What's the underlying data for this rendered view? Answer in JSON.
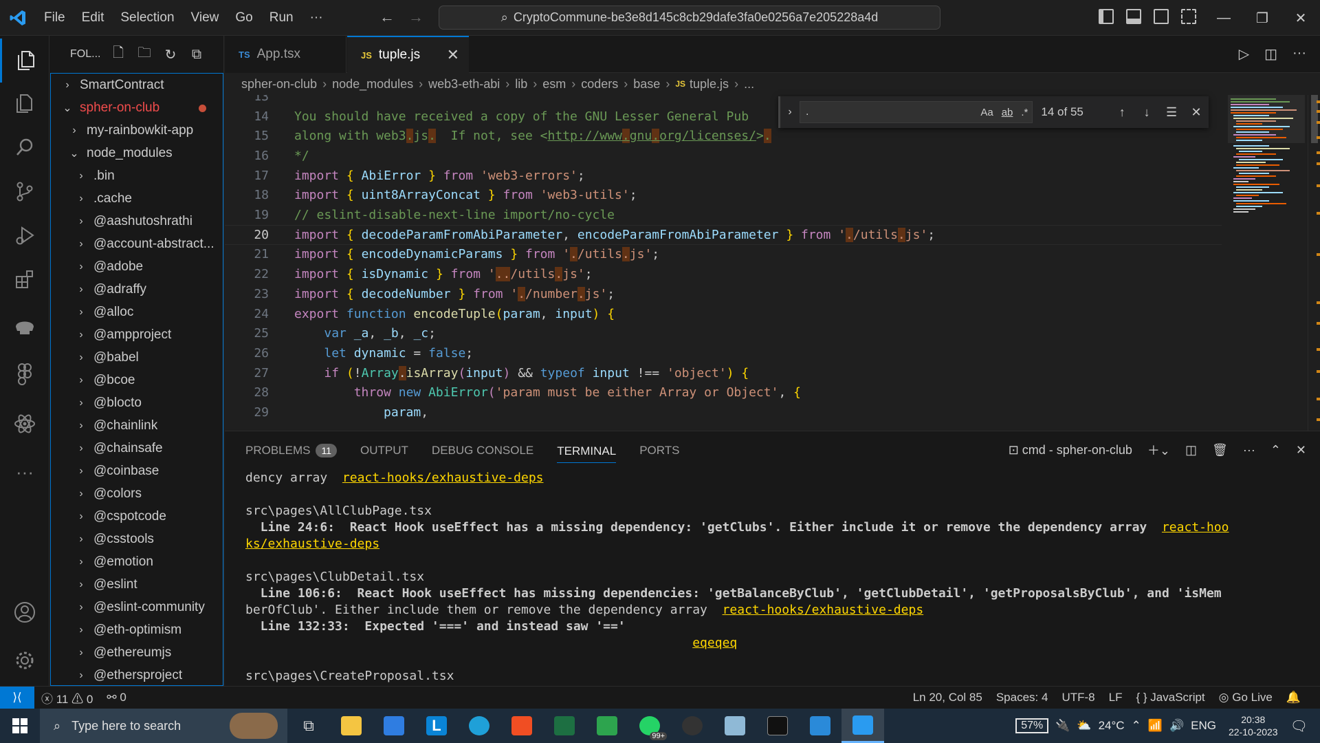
{
  "titlebar": {
    "menu": [
      "File",
      "Edit",
      "Selection",
      "View",
      "Go",
      "Run",
      "···"
    ],
    "command_center": "CryptoCommune-be3e8d145c8cb29dafe3fa0e0256a7e205228a4d"
  },
  "sidebar": {
    "title": "FOL...",
    "items": [
      {
        "label": "SmartContract",
        "chevron": "›",
        "indent": 0
      },
      {
        "label": "spher-on-club",
        "chevron": "⌄",
        "indent": 0,
        "modified": true
      },
      {
        "label": "my-rainbowkit-app",
        "chevron": "›",
        "indent": 1
      },
      {
        "label": "node_modules",
        "chevron": "⌄",
        "indent": 1
      },
      {
        "label": ".bin",
        "chevron": "›",
        "indent": 2
      },
      {
        "label": ".cache",
        "chevron": "›",
        "indent": 2
      },
      {
        "label": "@aashutoshrathi",
        "chevron": "›",
        "indent": 2
      },
      {
        "label": "@account-abstract...",
        "chevron": "›",
        "indent": 2
      },
      {
        "label": "@adobe",
        "chevron": "›",
        "indent": 2
      },
      {
        "label": "@adraffy",
        "chevron": "›",
        "indent": 2
      },
      {
        "label": "@alloc",
        "chevron": "›",
        "indent": 2
      },
      {
        "label": "@ampproject",
        "chevron": "›",
        "indent": 2
      },
      {
        "label": "@babel",
        "chevron": "›",
        "indent": 2
      },
      {
        "label": "@bcoe",
        "chevron": "›",
        "indent": 2
      },
      {
        "label": "@blocto",
        "chevron": "›",
        "indent": 2
      },
      {
        "label": "@chainlink",
        "chevron": "›",
        "indent": 2
      },
      {
        "label": "@chainsafe",
        "chevron": "›",
        "indent": 2
      },
      {
        "label": "@coinbase",
        "chevron": "›",
        "indent": 2
      },
      {
        "label": "@colors",
        "chevron": "›",
        "indent": 2
      },
      {
        "label": "@cspotcode",
        "chevron": "›",
        "indent": 2
      },
      {
        "label": "@csstools",
        "chevron": "›",
        "indent": 2
      },
      {
        "label": "@emotion",
        "chevron": "›",
        "indent": 2
      },
      {
        "label": "@eslint",
        "chevron": "›",
        "indent": 2
      },
      {
        "label": "@eslint-community",
        "chevron": "›",
        "indent": 2
      },
      {
        "label": "@eth-optimism",
        "chevron": "›",
        "indent": 2
      },
      {
        "label": "@ethereumjs",
        "chevron": "›",
        "indent": 2
      },
      {
        "label": "@ethersproject",
        "chevron": "›",
        "indent": 2
      }
    ]
  },
  "tabs": [
    {
      "label": "App.tsx",
      "lang": "TS"
    },
    {
      "label": "tuple.js",
      "lang": "JS",
      "close": "✕"
    }
  ],
  "breadcrumb": [
    "spher-on-club",
    "node_modules",
    "web3-eth-abi",
    "lib",
    "esm",
    "coders",
    "base",
    "tuple.js",
    "..."
  ],
  "breadcrumb_lang": "JS",
  "find": {
    "query": ".",
    "opt_case": "Aa",
    "opt_word": "ab",
    "opt_regex": ".*",
    "count": "14 of 55"
  },
  "editor": {
    "line_numbers": [
      "13",
      "14",
      "15",
      "16",
      "17",
      "18",
      "19",
      "20",
      "21",
      "22",
      "23",
      "24",
      "25",
      "26",
      "27",
      "28",
      "29"
    ],
    "current_line": "20"
  },
  "panel": {
    "tabs": [
      "PROBLEMS",
      "OUTPUT",
      "DEBUG CONSOLE",
      "TERMINAL",
      "PORTS"
    ],
    "problems_count": "11",
    "terminal_name": "cmd - spher-on-club",
    "terminal_lines": [
      {
        "text": "dency array  ",
        "link": "react-hooks/exhaustive-deps"
      },
      {
        "text": "",
        "link": ""
      },
      {
        "text": "src\\pages\\AllClubPage.tsx",
        "link": ""
      },
      {
        "text": "  Line 24:6:  React Hook useEffect has a missing dependency: 'getClubs'. Either include it or remove the dependency array  ",
        "link": "react-hoo"
      },
      {
        "text": "",
        "link": "ks/exhaustive-deps"
      },
      {
        "text": "",
        "link": ""
      },
      {
        "text": "src\\pages\\ClubDetail.tsx",
        "link": ""
      },
      {
        "text": "  Line 106:6:  React Hook useEffect has missing dependencies: 'getBalanceByClub', 'getClubDetail', 'getProposalsByClub', and 'isMem",
        "link": ""
      },
      {
        "text": "berOfClub'. Either include them or remove the dependency array  ",
        "link": "react-hooks/exhaustive-deps"
      },
      {
        "text": "  Line 132:33:  Expected '===' and instead saw '=='",
        "link": ""
      },
      {
        "text": "                                                            ",
        "link": "eqeqeq"
      },
      {
        "text": "",
        "link": ""
      },
      {
        "text": "src\\pages\\CreateProposal.tsx",
        "link": ""
      }
    ]
  },
  "statusbar": {
    "errors": "11",
    "warnings": "0",
    "ports": "0",
    "position": "Ln 20, Col 85",
    "spaces": "Spaces: 4",
    "encoding": "UTF-8",
    "eol": "LF",
    "language": "JavaScript",
    "golive": "Go Live"
  },
  "taskbar": {
    "search_placeholder": "Type here to search",
    "battery": "57%",
    "temperature": "24°C",
    "language": "ENG",
    "time": "20:38",
    "date": "22-10-2023",
    "whatsapp_badge": "99+"
  }
}
